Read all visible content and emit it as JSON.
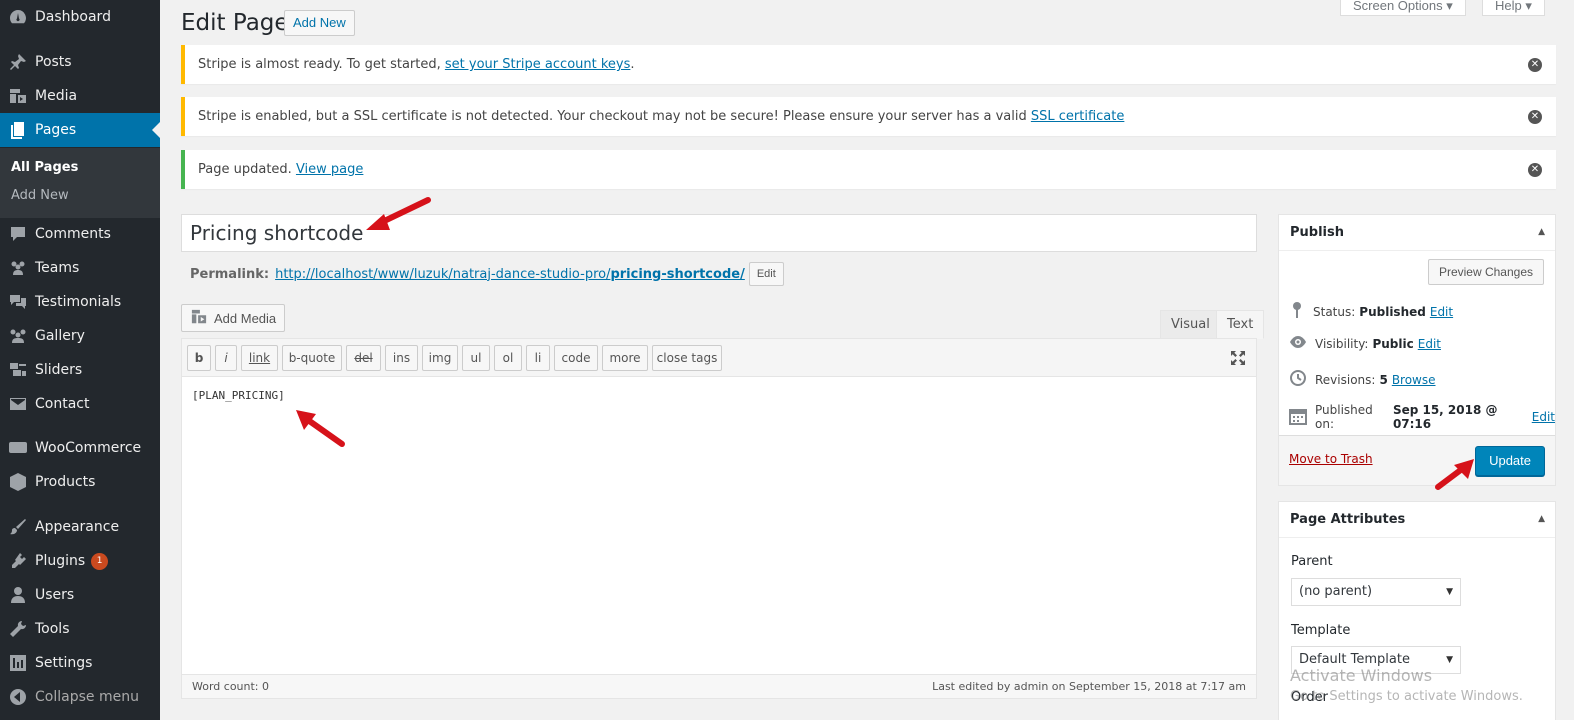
{
  "sidebar": {
    "items": [
      {
        "label": "Dashboard",
        "icon": "dashboard-icon"
      },
      {
        "label": "Posts",
        "icon": "pin-icon"
      },
      {
        "label": "Media",
        "icon": "media-icon"
      },
      {
        "label": "Pages",
        "icon": "pages-icon"
      },
      {
        "label": "Comments",
        "icon": "comment-icon"
      },
      {
        "label": "Teams",
        "icon": "team-icon"
      },
      {
        "label": "Testimonials",
        "icon": "testimonial-icon"
      },
      {
        "label": "Gallery",
        "icon": "gallery-icon"
      },
      {
        "label": "Sliders",
        "icon": "slider-icon"
      },
      {
        "label": "Contact",
        "icon": "mail-icon"
      },
      {
        "label": "WooCommerce",
        "icon": "woo-icon"
      },
      {
        "label": "Products",
        "icon": "product-icon"
      },
      {
        "label": "Appearance",
        "icon": "brush-icon"
      },
      {
        "label": "Plugins",
        "icon": "plugin-icon"
      },
      {
        "label": "Users",
        "icon": "user-icon"
      },
      {
        "label": "Tools",
        "icon": "wrench-icon"
      },
      {
        "label": "Settings",
        "icon": "settings-icon"
      },
      {
        "label": "Collapse menu",
        "icon": "collapse-icon"
      }
    ],
    "submenu": {
      "all_pages": "All Pages",
      "add_new": "Add New"
    },
    "plugins_badge": "1"
  },
  "header": {
    "title": "Edit Page",
    "add_new": "Add New",
    "screen_options": "Screen Options",
    "help": "Help"
  },
  "notices": [
    {
      "text": "Stripe is almost ready. To get started, ",
      "link": "set your Stripe account keys",
      "after": "."
    },
    {
      "text": "Stripe is enabled, but a SSL certificate is not detected. Your checkout may not be secure! Please ensure your server has a valid ",
      "link": "SSL certificate",
      "after": ""
    },
    {
      "text": "Page updated. ",
      "link": "View page",
      "after": ""
    }
  ],
  "editor": {
    "title_value": "Pricing shortcode",
    "permalink_label": "Permalink:",
    "permalink_base": "http://localhost/www/luzuk/natraj-dance-studio-pro/",
    "permalink_slug": "pricing-shortcode/",
    "permalink_edit": "Edit",
    "add_media": "Add Media",
    "tab_visual": "Visual",
    "tab_text": "Text",
    "quicktags": [
      "b",
      "i",
      "link",
      "b-quote",
      "del",
      "ins",
      "img",
      "ul",
      "ol",
      "li",
      "code",
      "more",
      "close tags"
    ],
    "content": "[PLAN_PRICING]",
    "word_count": "Word count: 0",
    "last_edited": "Last edited by admin on September 15, 2018 at 7:17 am"
  },
  "publish": {
    "title": "Publish",
    "preview": "Preview Changes",
    "status_label": "Status:",
    "status_value": "Published",
    "visibility_label": "Visibility:",
    "visibility_value": "Public",
    "revisions_label": "Revisions:",
    "revisions_value": "5",
    "revisions_link": "Browse",
    "published_label": "Published on:",
    "published_value": "Sep 15, 2018 @ 07:16",
    "edit": "Edit",
    "trash": "Move to Trash",
    "update": "Update"
  },
  "attributes": {
    "title": "Page Attributes",
    "parent_label": "Parent",
    "parent_value": "(no parent)",
    "template_label": "Template",
    "template_value": "Default Template",
    "order_label": "Order"
  },
  "watermark": {
    "line1": "Activate Windows",
    "line2": "Go to Settings to activate Windows."
  },
  "colors": {
    "sidebar_bg": "#23282d",
    "accent": "#0073aa",
    "warning": "#ffb900",
    "success": "#46b450",
    "annotation_arrow": "#e01a1a"
  }
}
